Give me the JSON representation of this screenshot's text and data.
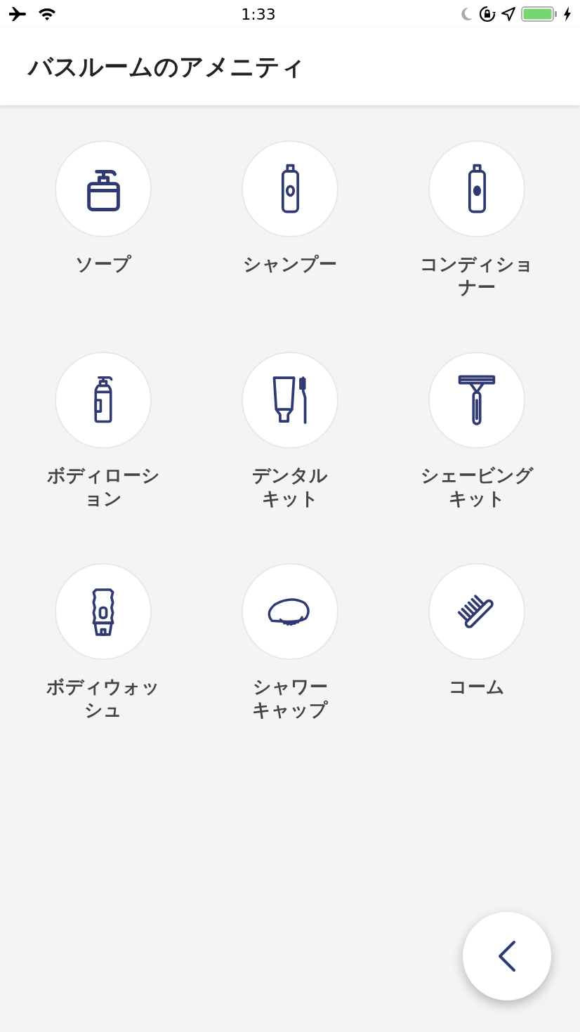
{
  "status_bar": {
    "time": "1:33"
  },
  "header": {
    "title": "バスルームのアメニティ"
  },
  "amenities": [
    {
      "kind": "soap",
      "label_lines": [
        "ソープ"
      ]
    },
    {
      "kind": "shampoo",
      "label_lines": [
        "シャンプー"
      ]
    },
    {
      "kind": "conditioner",
      "label_lines": [
        "コンディショナー"
      ]
    },
    {
      "kind": "lotion",
      "label_lines": [
        "ボディローション"
      ]
    },
    {
      "kind": "dental",
      "label_lines": [
        "デンタル",
        "キット"
      ]
    },
    {
      "kind": "razor",
      "label_lines": [
        "シェービング",
        "キット"
      ]
    },
    {
      "kind": "bodywash",
      "label_lines": [
        "ボディウォッシュ"
      ]
    },
    {
      "kind": "cap",
      "label_lines": [
        "シャワー",
        "キャップ"
      ]
    },
    {
      "kind": "comb",
      "label_lines": [
        "コーム"
      ]
    }
  ],
  "back_button": {
    "kind": "chevron-left"
  }
}
